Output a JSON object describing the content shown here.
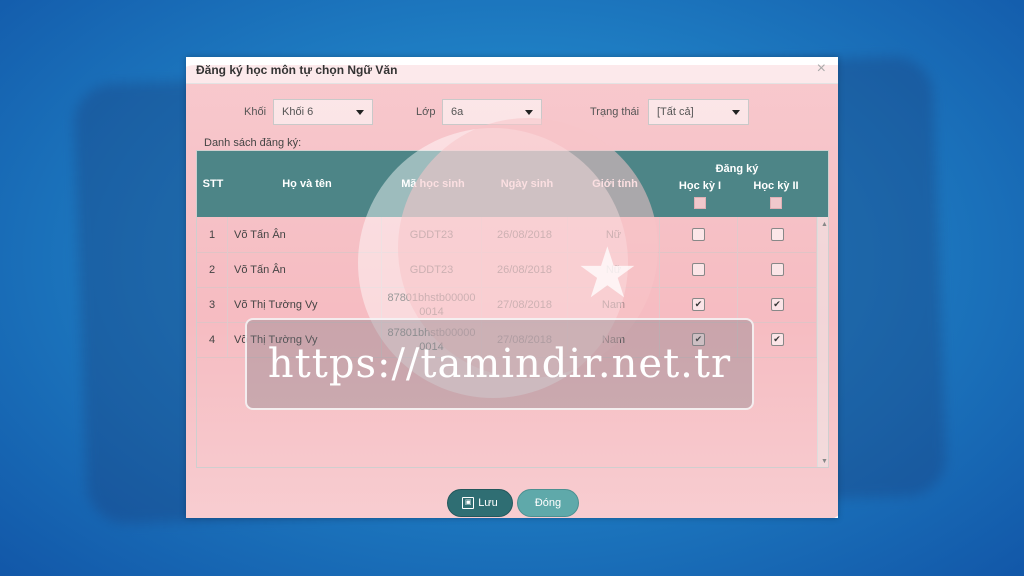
{
  "dialog": {
    "title": "Đăng ký học môn tự chọn Ngữ Văn",
    "close_glyph": "×"
  },
  "filters": {
    "khoi": {
      "label": "Khối",
      "value": "Khối 6"
    },
    "lop": {
      "label": "Lớp",
      "value": "6a"
    },
    "trangthai": {
      "label": "Trạng thái",
      "value": "[Tất cả]"
    }
  },
  "list_label": "Danh sách đăng ký:",
  "table": {
    "headers": {
      "stt": "STT",
      "name": "Họ và tên",
      "code": "Mã học sinh",
      "dob": "Ngày sinh",
      "gender": "Giới tính",
      "register": "Đăng ký",
      "term1": "Học kỳ I",
      "term2": "Học kỳ II"
    },
    "rows": [
      {
        "stt": "1",
        "name": "Võ Tấn Ân",
        "code": "GDDT23",
        "dob": "26/08/2018",
        "gender": "Nữ",
        "term1": false,
        "term2": false
      },
      {
        "stt": "2",
        "name": "Võ Tấn Ân",
        "code": "GDDT23",
        "dob": "26/08/2018",
        "gender": "Nữ",
        "term1": false,
        "term2": false
      },
      {
        "stt": "3",
        "name": "Võ Thị Tường Vy",
        "code": "87801bhstb00000 0014",
        "dob": "27/08/2018",
        "gender": "Nam",
        "term1": true,
        "term2": true
      },
      {
        "stt": "4",
        "name": "Võ Thị Tường Vy",
        "code": "87801bhstb00000 0014",
        "dob": "27/08/2018",
        "gender": "Nam",
        "term1": true,
        "term2": true
      }
    ]
  },
  "buttons": {
    "save": "Lưu",
    "close": "Đóng"
  },
  "watermark": "https://tamindir.net.tr",
  "icons": {
    "close": "close-icon",
    "save": "save-icon",
    "dropdown": "chevron-down-icon",
    "check": "check-icon"
  },
  "colors": {
    "header": "#4d8587",
    "save_button": "#2f6e73",
    "close_button": "#5fa9aa",
    "background": "#1f7fc4"
  }
}
